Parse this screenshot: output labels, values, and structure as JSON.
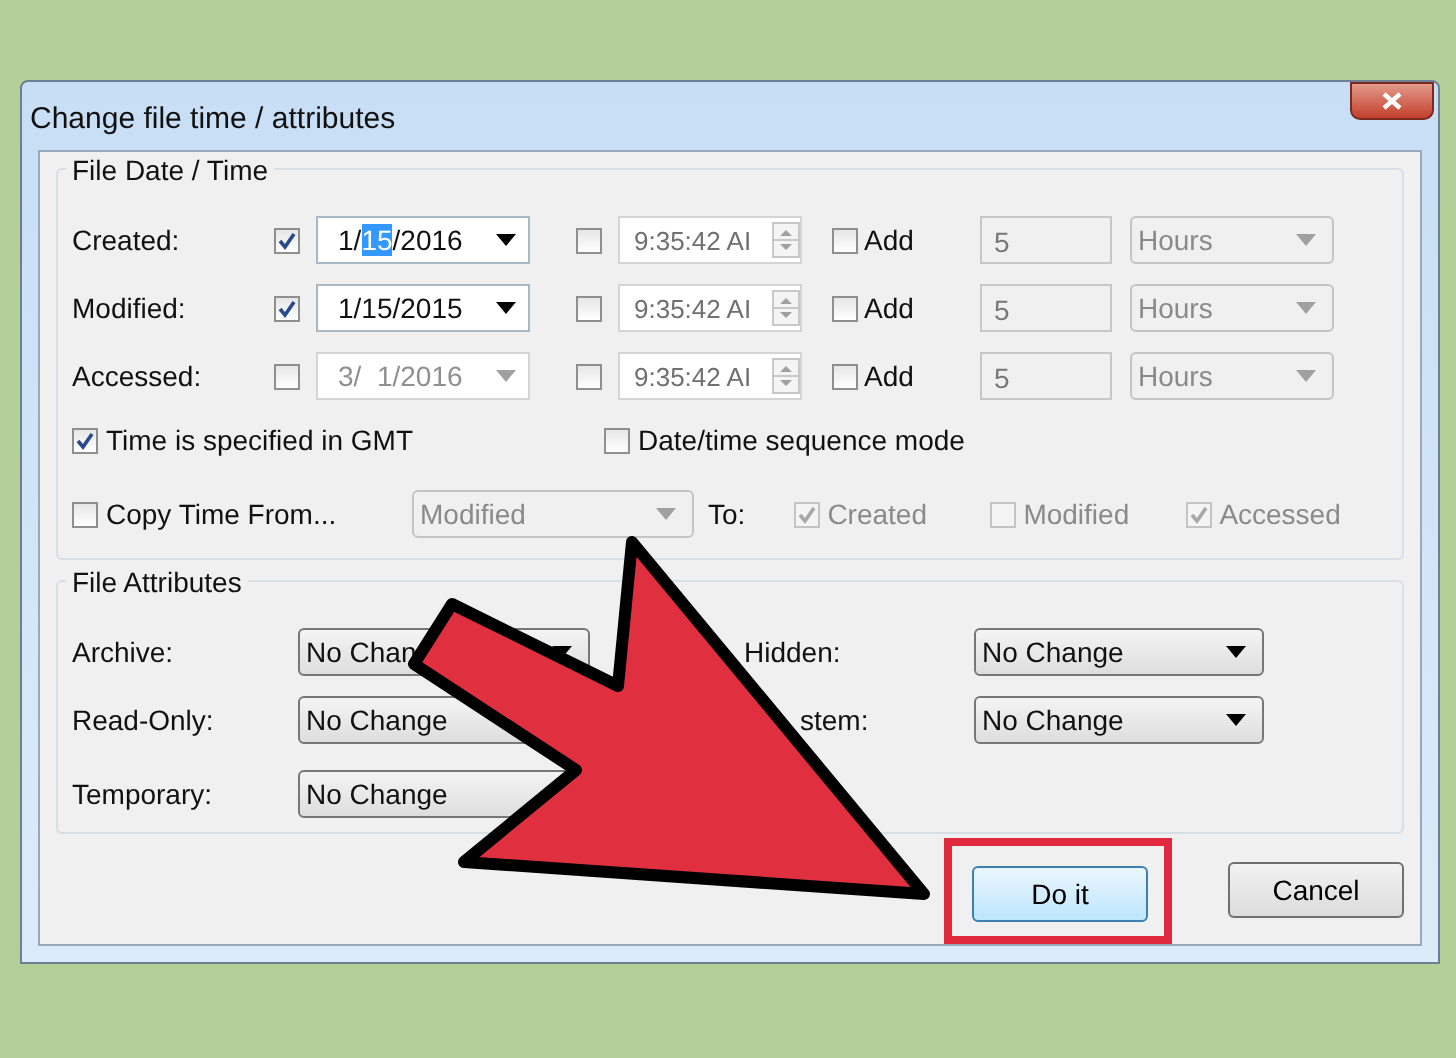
{
  "window": {
    "title": "Change file time / attributes"
  },
  "date_time": {
    "title": "File Date / Time",
    "rows": [
      {
        "label": "Created:",
        "date_checked": true,
        "date_parts": [
          {
            "text": "1/",
            "selected": false
          },
          {
            "text": "15",
            "selected": true
          },
          {
            "text": "/2016",
            "selected": false
          }
        ],
        "date_disabled": false,
        "time_checked": false,
        "time": "9:35:42 AI",
        "add_checked": false,
        "add_label": "Add",
        "amount": "5",
        "unit": "Hours"
      },
      {
        "label": "Modified:",
        "date_checked": true,
        "date_parts": [
          {
            "text": "1/15/2015",
            "selected": false
          }
        ],
        "date_disabled": false,
        "time_checked": false,
        "time": "9:35:42 AI",
        "add_checked": false,
        "add_label": "Add",
        "amount": "5",
        "unit": "Hours"
      },
      {
        "label": "Accessed:",
        "date_checked": false,
        "date_parts": [
          {
            "text": "3/  1/2016",
            "selected": false
          }
        ],
        "date_disabled": true,
        "time_checked": false,
        "time": "9:35:42 AI",
        "add_checked": false,
        "add_label": "Add",
        "amount": "5",
        "unit": "Hours"
      }
    ],
    "options": [
      {
        "label": "Time is specified in GMT",
        "checked": true
      },
      {
        "label": "Date/time sequence mode",
        "checked": false
      }
    ],
    "copy": {
      "label": "Copy Time From...",
      "checked": false,
      "source": "Modified",
      "source_disabled": true,
      "to_label": "To:",
      "targets": [
        {
          "label": "Created",
          "checked": true,
          "disabled": true
        },
        {
          "label": "Modified",
          "checked": false,
          "disabled": true
        },
        {
          "label": "Accessed",
          "checked": true,
          "disabled": true
        }
      ]
    }
  },
  "attributes": {
    "title": "File Attributes",
    "items": [
      {
        "label": "Archive:",
        "value": "No Chan"
      },
      {
        "label": "Hidden:",
        "value": "No Change"
      },
      {
        "label": "Read-Only:",
        "value": "No Change"
      },
      {
        "label": "stem:",
        "value": "No Change"
      },
      {
        "label": "Temporary:",
        "value": "No Change"
      }
    ]
  },
  "buttons": [
    {
      "label": "Do it",
      "highlighted": true
    },
    {
      "label": "Cancel",
      "highlighted": false
    }
  ]
}
